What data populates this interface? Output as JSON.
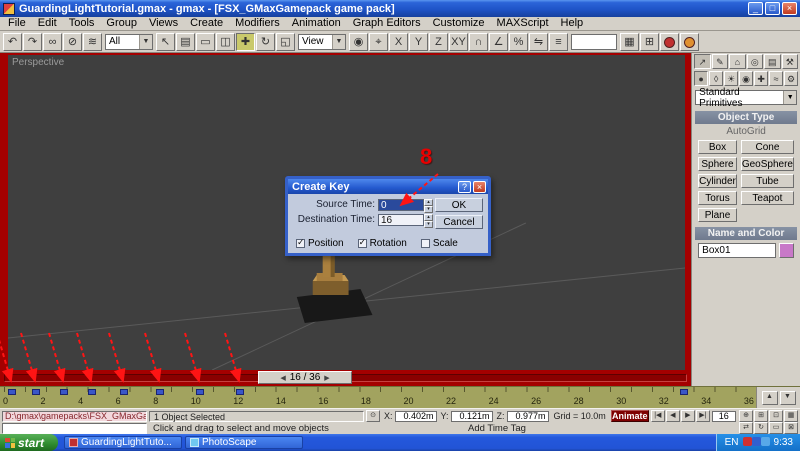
{
  "window": {
    "title": "GuardingLightTutorial.gmax - gmax - [FSX_GMaxGamepack game pack]",
    "minimize": "_",
    "maximize": "□",
    "close": "×"
  },
  "menubar": {
    "items": [
      "File",
      "Edit",
      "Tools",
      "Group",
      "Views",
      "Create",
      "Modifiers",
      "Animation",
      "Graph Editors",
      "Customize",
      "MAXScript",
      "Help"
    ]
  },
  "toolbar": {
    "items": [
      {
        "type": "btn",
        "name": "undo-icon",
        "glyph": "↶"
      },
      {
        "type": "btn",
        "name": "redo-icon",
        "glyph": "↷"
      },
      {
        "type": "btn",
        "name": "select-and-link-icon",
        "glyph": "∞"
      },
      {
        "type": "btn",
        "name": "unlink-selection-icon",
        "glyph": "⊘"
      },
      {
        "type": "btn",
        "name": "bind-to-space-warp-icon",
        "glyph": "≋"
      },
      {
        "type": "dropdown",
        "name": "selection-filter-dropdown",
        "label": "All"
      },
      {
        "type": "btn",
        "name": "select-object-icon",
        "glyph": "↖"
      },
      {
        "type": "btn",
        "name": "select-by-name-icon",
        "glyph": "▤"
      },
      {
        "type": "btn",
        "name": "rectangular-selection-icon",
        "glyph": "▭"
      },
      {
        "type": "btn",
        "name": "window-crossing-icon",
        "glyph": "◫"
      },
      {
        "type": "btn",
        "name": "select-and-move-icon",
        "glyph": "✚",
        "active": true
      },
      {
        "type": "btn",
        "name": "select-and-rotate-icon",
        "glyph": "↻"
      },
      {
        "type": "btn",
        "name": "select-and-scale-icon",
        "glyph": "◱"
      },
      {
        "type": "dropdown",
        "name": "reference-coordinate-dropdown",
        "label": "View"
      },
      {
        "type": "btn",
        "name": "use-pivot-center-icon",
        "glyph": "◉"
      },
      {
        "type": "btn",
        "name": "select-and-manipulate-icon",
        "glyph": "⌖"
      },
      {
        "type": "btn",
        "name": "axis-x-button",
        "glyph": "X"
      },
      {
        "type": "btn",
        "name": "axis-y-button",
        "glyph": "Y"
      },
      {
        "type": "btn",
        "name": "axis-z-button",
        "glyph": "Z"
      },
      {
        "type": "btn",
        "name": "axis-xy-button",
        "glyph": "XY"
      },
      {
        "type": "btn",
        "name": "snap-toggle-icon",
        "glyph": "∩"
      },
      {
        "type": "btn",
        "name": "angle-snap-icon",
        "glyph": "∠"
      },
      {
        "type": "btn",
        "name": "percent-snap-icon",
        "glyph": "%"
      },
      {
        "type": "btn",
        "name": "mirror-icon",
        "glyph": "⇋"
      },
      {
        "type": "btn",
        "name": "align-icon",
        "glyph": "≡"
      },
      {
        "type": "field",
        "name": "named-selection-field"
      },
      {
        "type": "btn",
        "name": "track-view-icon",
        "glyph": "▦"
      },
      {
        "type": "btn",
        "name": "schematic-view-icon",
        "glyph": "⊞"
      },
      {
        "type": "ball",
        "name": "material-editor-icon",
        "color": "#C03030"
      },
      {
        "type": "ball",
        "name": "render-icon",
        "color": "#E09030"
      }
    ]
  },
  "viewport": {
    "label": "Perspective"
  },
  "dialog": {
    "title": "Create Key",
    "help_button": "?",
    "close_button": "×",
    "rows": [
      {
        "label": "Source Time:",
        "value": "0"
      },
      {
        "label": "Destination Time:",
        "value": "16"
      }
    ],
    "ok": "OK",
    "cancel": "Cancel",
    "checkboxes": [
      {
        "label": "Position",
        "checked": true
      },
      {
        "label": "Rotation",
        "checked": true
      },
      {
        "label": "Scale",
        "checked": false
      }
    ]
  },
  "annotation": {
    "step": "8"
  },
  "timeslider": {
    "label": "16 / 36"
  },
  "trackbar": {
    "tick_labels": [
      "0",
      "2",
      "4",
      "6",
      "8",
      "10",
      "12",
      "14",
      "16",
      "18",
      "20",
      "22",
      "24",
      "26",
      "28",
      "30",
      "32",
      "34",
      "36"
    ],
    "key_positions_pct": [
      1,
      4,
      7.5,
      11,
      15,
      19.5,
      24.5,
      29.5,
      85
    ]
  },
  "statusbar": {
    "listener_text": "D:\\gmax\\gamepacks\\FSX_GMaxGamepack\\*",
    "selection_status": "1 Object Selected",
    "prompt": "Click and drag to select and move objects",
    "coord_x_label": "X:",
    "coord_x": "0.402m",
    "coord_y_label": "Y:",
    "coord_y": "0.121m",
    "coord_z_label": "Z:",
    "coord_z": "0.977m",
    "grid_label": "Grid = 10.0m",
    "add_time_tag": "Add Time Tag",
    "animate_label": "Animate",
    "frame_field": "16"
  },
  "playback": {
    "buttons": [
      {
        "name": "go-to-start-button",
        "glyph": "|◀"
      },
      {
        "name": "previous-frame-button",
        "glyph": "◀"
      },
      {
        "name": "play-button",
        "glyph": "▶"
      },
      {
        "name": "go-to-end-button",
        "glyph": "▶|"
      }
    ]
  },
  "nav": {
    "row1": [
      {
        "name": "zoom-icon",
        "glyph": "⊕"
      },
      {
        "name": "zoom-all-icon",
        "glyph": "⊞"
      },
      {
        "name": "zoom-extents-icon",
        "glyph": "⊡"
      },
      {
        "name": "zoom-region-icon",
        "glyph": "▦"
      }
    ],
    "row2": [
      {
        "name": "pan-icon",
        "glyph": "⇄"
      },
      {
        "name": "arc-rotate-icon",
        "glyph": "↻"
      },
      {
        "name": "field-of-view-icon",
        "glyph": "▭"
      },
      {
        "name": "min-max-toggle-icon",
        "glyph": "⊠"
      }
    ]
  },
  "command_panel": {
    "tabs": [
      {
        "name": "tab-create",
        "glyph": "↗",
        "active": true
      },
      {
        "name": "tab-modify",
        "glyph": "✎"
      },
      {
        "name": "tab-hierarchy",
        "glyph": "⌂"
      },
      {
        "name": "tab-motion",
        "glyph": "◎"
      },
      {
        "name": "tab-display",
        "glyph": "▤"
      },
      {
        "name": "tab-utilities",
        "glyph": "⚒"
      }
    ],
    "categories": [
      {
        "name": "category-geometry",
        "glyph": "●",
        "active": true
      },
      {
        "name": "category-shapes",
        "glyph": "◊"
      },
      {
        "name": "category-lights",
        "glyph": "☀"
      },
      {
        "name": "category-cameras",
        "glyph": "◉"
      },
      {
        "name": "category-helpers",
        "glyph": "✚"
      },
      {
        "name": "category-space-warps",
        "glyph": "≈"
      },
      {
        "name": "category-systems",
        "glyph": "⚙"
      }
    ],
    "primitives_dropdown": "Standard Primitives",
    "rollout_object_type": "Object Type",
    "autogrid_label": "AutoGrid",
    "object_buttons": [
      "Box",
      "Cone",
      "Sphere",
      "GeoSphere",
      "Cylinder",
      "Tube",
      "Torus",
      "Teapot",
      "Plane"
    ],
    "rollout_name_color": "Name and Color",
    "object_name": "Box01"
  },
  "taskbar": {
    "start_label": "start",
    "tasks": [
      {
        "name": "taskbar-button-gmax",
        "label": "GuardingLightTuto...",
        "icon_color": "#C03030"
      },
      {
        "name": "taskbar-button-photoscape",
        "label": "PhotoScape",
        "icon_color": "#70C8F0"
      }
    ],
    "tray": {
      "lang": "EN",
      "icons": [
        {
          "name": "antivirus-tray-icon",
          "color": "#D03030"
        },
        {
          "name": "network-tray-icon",
          "color": "#3060D0"
        },
        {
          "name": "volume-tray-icon",
          "color": "#58A8E8"
        }
      ],
      "time": "9:33"
    }
  },
  "colors": {
    "ui_red": "#A40000",
    "annotation_red": "#FF1414",
    "key_blue": "#3A56C8",
    "viewport_gray": "#3F3F3F",
    "ruler_olive": "#A2A35F"
  }
}
